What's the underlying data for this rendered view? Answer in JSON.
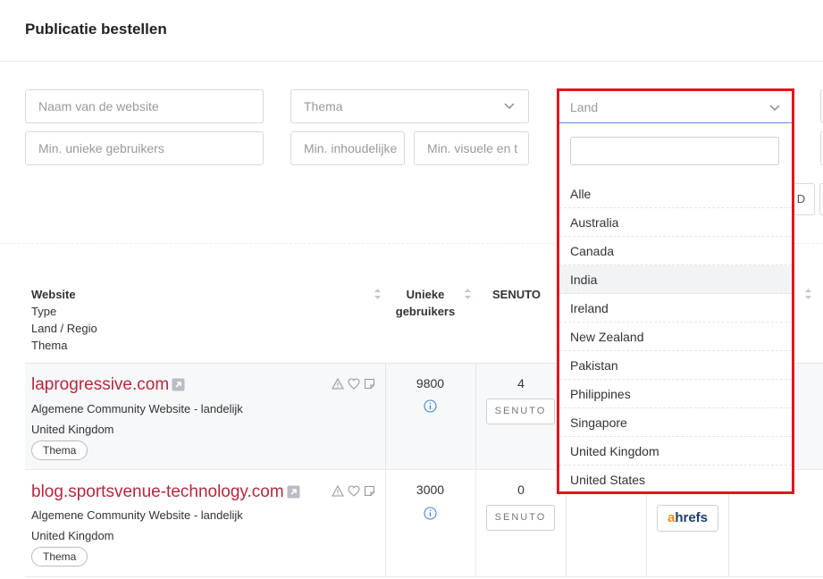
{
  "header": {
    "title": "Publicatie bestellen"
  },
  "filters": {
    "website_name_placeholder": "Naam van de website",
    "theme_placeholder": "Thema",
    "min_users_placeholder": "Min. unieke gebruikers",
    "min_content_placeholder": "Min. inhoudelijke",
    "min_visual_placeholder": "Min. visuele en t",
    "land_placeholder": "Land",
    "partial_button_label": "D"
  },
  "land_dropdown": {
    "search_value": "",
    "options": [
      "Alle",
      "Australia",
      "Canada",
      "India",
      "Ireland",
      "New Zealand",
      "Pakistan",
      "Philippines",
      "Singapore",
      "United Kingdom",
      "United States"
    ],
    "hovered_option": "India"
  },
  "table": {
    "headers": {
      "website_lines": [
        "Website",
        "Type",
        "Land / Regio",
        "Thema"
      ],
      "users_lines": [
        "Unieke",
        "gebruikers"
      ],
      "senuto": "SENUTO"
    },
    "rows": [
      {
        "site": "laprogressive.com",
        "type": "Algemene Community Website - landelijk",
        "country": "United Kingdom",
        "tag": "Thema",
        "users": "9800",
        "senuto_value": "4",
        "senuto_label": "SENUTO"
      },
      {
        "site": "blog.sportsvenue-technology.com",
        "type": "Algemene Community Website - landelijk",
        "country": "United Kingdom",
        "tag": "Thema",
        "users": "3000",
        "senuto_value": "0",
        "senuto_label": "SENUTO",
        "ahrefs_label": "hrefs",
        "ahrefs_prefix": "a"
      }
    ]
  },
  "colors": {
    "link": "#b5283d",
    "dropdown_border": "#e0161e",
    "ahrefs_orange": "#f38f1d",
    "ahrefs_blue": "#1a3e6d"
  }
}
